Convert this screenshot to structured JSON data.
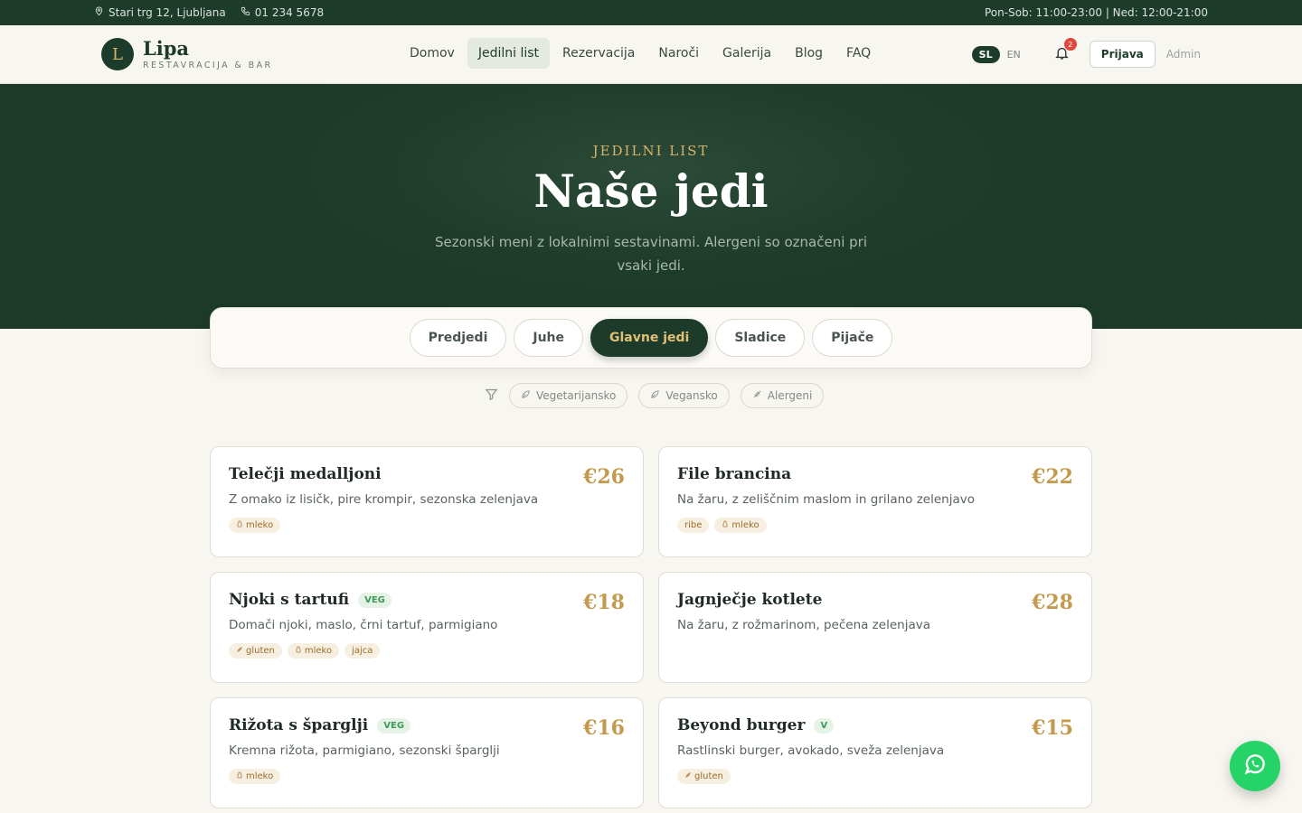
{
  "topbar": {
    "address": "Stari trg 12, Ljubljana",
    "phone": "01 234 5678",
    "hours": "Pon-Sob: 11:00-23:00 | Ned: 12:00-21:00"
  },
  "brand": {
    "initial": "L",
    "name": "Lipa",
    "tagline": "RESTAVRACIJA & BAR"
  },
  "nav": [
    {
      "label": "Domov"
    },
    {
      "label": "Jedilni list"
    },
    {
      "label": "Rezervacija"
    },
    {
      "label": "Naroči"
    },
    {
      "label": "Galerija"
    },
    {
      "label": "Blog"
    },
    {
      "label": "FAQ"
    }
  ],
  "lang": {
    "active": "SL",
    "other": "EN"
  },
  "notifications": {
    "count": "2"
  },
  "auth": {
    "login": "Prijava",
    "admin": "Admin"
  },
  "hero": {
    "eyebrow": "JEDILNI LIST",
    "title": "Naše jedi",
    "subtitle": "Sezonski meni z lokalnimi sestavinami. Alergeni so označeni pri vsaki jedi."
  },
  "tabs": [
    {
      "label": "Predjedi"
    },
    {
      "label": "Juhe"
    },
    {
      "label": "Glavne jedi"
    },
    {
      "label": "Sladice"
    },
    {
      "label": "Pijače"
    }
  ],
  "filters": [
    {
      "label": "Vegetarijansko"
    },
    {
      "label": "Vegansko"
    },
    {
      "label": "Alergeni"
    }
  ],
  "dishes": [
    {
      "name": "Telečji medalljoni",
      "price": "€26",
      "desc": "Z omako iz lisičk, pire krompir, sezonska zelenjava",
      "tag": "",
      "allergens": [
        "mleko"
      ]
    },
    {
      "name": "File brancina",
      "price": "€22",
      "desc": "Na žaru, z zeliščnim maslom in grilano zelenjavo",
      "tag": "",
      "allergens": [
        "ribe",
        "mleko"
      ]
    },
    {
      "name": "Njoki s tartufi",
      "price": "€18",
      "desc": "Domači njoki, maslo, črni tartuf, parmigiano",
      "tag": "VEG",
      "allergens": [
        "gluten",
        "mleko",
        "jajca"
      ]
    },
    {
      "name": "Jagnječje kotlete",
      "price": "€28",
      "desc": "Na žaru, z rožmarinom, pečena zelenjava",
      "tag": "",
      "allergens": []
    },
    {
      "name": "Rižota s šparglji",
      "price": "€16",
      "desc": "Kremna rižota, parmigiano, sezonski šparglji",
      "tag": "VEG",
      "allergens": [
        "mleko"
      ]
    },
    {
      "name": "Beyond burger",
      "price": "€15",
      "desc": "Rastlinski burger, avokado, sveža zelenjava",
      "tag": "V",
      "allergens": [
        "gluten"
      ]
    }
  ],
  "colors": {
    "primary": "#1d3b2a",
    "accent": "#c49b4e",
    "whatsapp": "#25d366"
  }
}
